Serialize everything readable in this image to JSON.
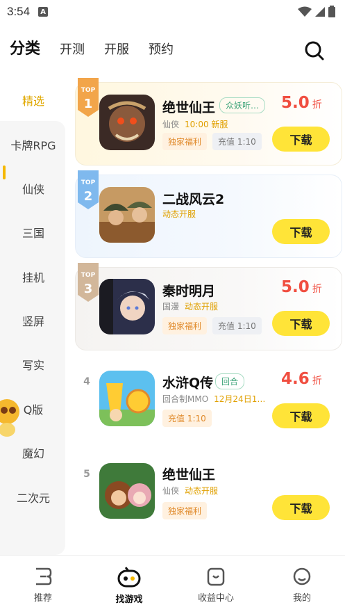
{
  "status": {
    "time": "3:54",
    "notification_icon": "A"
  },
  "top_tabs": [
    {
      "label": "分类",
      "active": true
    },
    {
      "label": "开测"
    },
    {
      "label": "开服"
    },
    {
      "label": "预约"
    }
  ],
  "sidebar": {
    "items": [
      "精选",
      "卡牌RPG",
      "仙侠",
      "三国",
      "挂机",
      "竖屏",
      "写实",
      "Q版",
      "魔幻",
      "二次元"
    ],
    "active_index": 0
  },
  "games": [
    {
      "rank_badge": "TOP",
      "rank": "1",
      "name": "绝世仙王",
      "tag": "众妖听…",
      "genre": "仙侠",
      "extra": "10:00 新服",
      "chips": [
        "独家福利",
        "充值 1:10"
      ],
      "discount": "5.0",
      "discount_unit": "折",
      "button": "下载"
    },
    {
      "rank_badge": "TOP",
      "rank": "2",
      "name": "二战风云2",
      "tag": "",
      "genre": "",
      "extra": "动态开服",
      "chips": [],
      "discount": "",
      "discount_unit": "",
      "button": "下载"
    },
    {
      "rank_badge": "TOP",
      "rank": "3",
      "name": "秦时明月",
      "tag": "",
      "genre": "国漫",
      "extra": "动态开服",
      "chips": [
        "独家福利",
        "充值 1:10"
      ],
      "discount": "5.0",
      "discount_unit": "折",
      "button": "下载"
    },
    {
      "rank": "4",
      "name": "水浒Q传",
      "tag": "回合",
      "genre": "回合制MMO",
      "extra": "12月24日1…",
      "chips": [
        "充值 1:10"
      ],
      "discount": "4.6",
      "discount_unit": "折",
      "button": "下载"
    },
    {
      "rank": "5",
      "name": "绝世仙王",
      "tag": "",
      "genre": "仙侠",
      "extra": "动态开服",
      "chips": [
        "独家福利"
      ],
      "discount": "",
      "discount_unit": "",
      "button": "下载"
    }
  ],
  "bottom_nav": [
    {
      "label": "推荐"
    },
    {
      "label": "找游戏",
      "active": true
    },
    {
      "label": "收益中心"
    },
    {
      "label": "我的"
    }
  ],
  "colors": {
    "accent_yellow": "#ffe438",
    "discount_red": "#f04e40",
    "sidebar_active": "#e0a800"
  }
}
